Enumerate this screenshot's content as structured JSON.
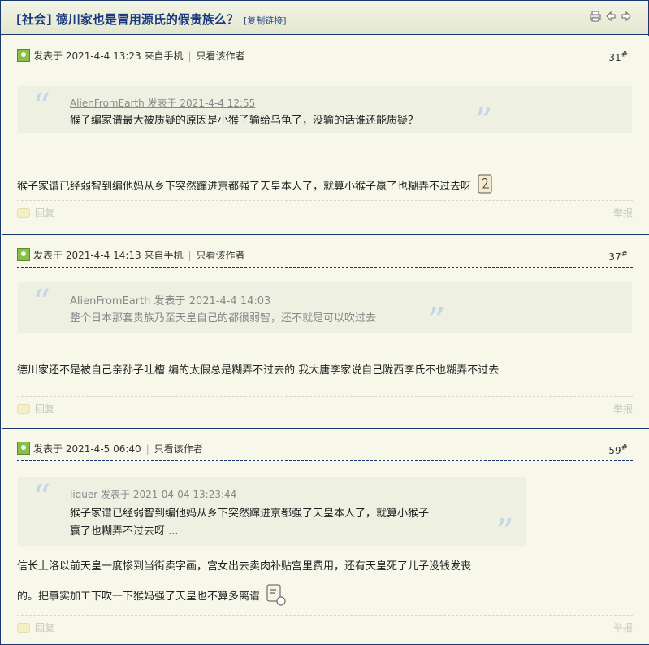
{
  "thread": {
    "title": "[社会] 德川家也是冒用源氏的假贵族么？",
    "copy_link": "[复制链接]"
  },
  "icons": [
    "print-icon",
    "prev-icon",
    "next-icon"
  ],
  "posts": [
    {
      "meta": "发表于 2021-4-4 13:23 来自手机",
      "only_author": "只看该作者",
      "floor": "31",
      "quote": {
        "author": "AlienFromEarth 发表于 2021-4-4 12:55",
        "lines": [
          "猴子编家谱最大被质疑的原因是小猴子输给乌龟了，没输的话谁还能质疑？"
        ]
      },
      "body_lines": [
        "猴子家谱已经弱智到编他妈从乡下突然蹿进京都强了天皇本人了，就算小猴子赢了也糊弄不过去呀"
      ],
      "reply": "回复",
      "report": "举报"
    },
    {
      "meta": "发表于 2021-4-4 14:13 来自手机",
      "only_author": "只看该作者",
      "floor": "37",
      "quote": {
        "author": "AlienFromEarth 发表于 2021-4-4 14:03",
        "lines": [
          "整个日本那套贵族乃至天皇自己的都很弱智，还不就是可以吹过去"
        ]
      },
      "body_lines": [
        "德川家还不是被自己亲孙子吐槽 编的太假总是糊弄不过去的 我大唐李家说自己陇西李氏不也糊弄不过去"
      ],
      "reply": "回复",
      "report": "举报"
    },
    {
      "meta": "发表于 2021-4-5 06:40",
      "only_author": "只看该作者",
      "floor": "59",
      "quote": {
        "author": "liquer 发表于 2021-04-04 13:23:44",
        "lines": [
          "猴子家谱已经弱智到编他妈从乡下突然蹿进京都强了天皇本人了，就算小猴子",
          "赢了也糊弄不过去呀 ..."
        ]
      },
      "body_lines": [
        "信长上洛以前天皇一度惨到当街卖字画，宫女出去卖肉补贴宫里费用，还有天皇死了儿子没钱发丧",
        "的。把事实加工下吹一下猴妈强了天皇也不算多离谱"
      ],
      "reply": "回复",
      "report": "举报"
    }
  ]
}
